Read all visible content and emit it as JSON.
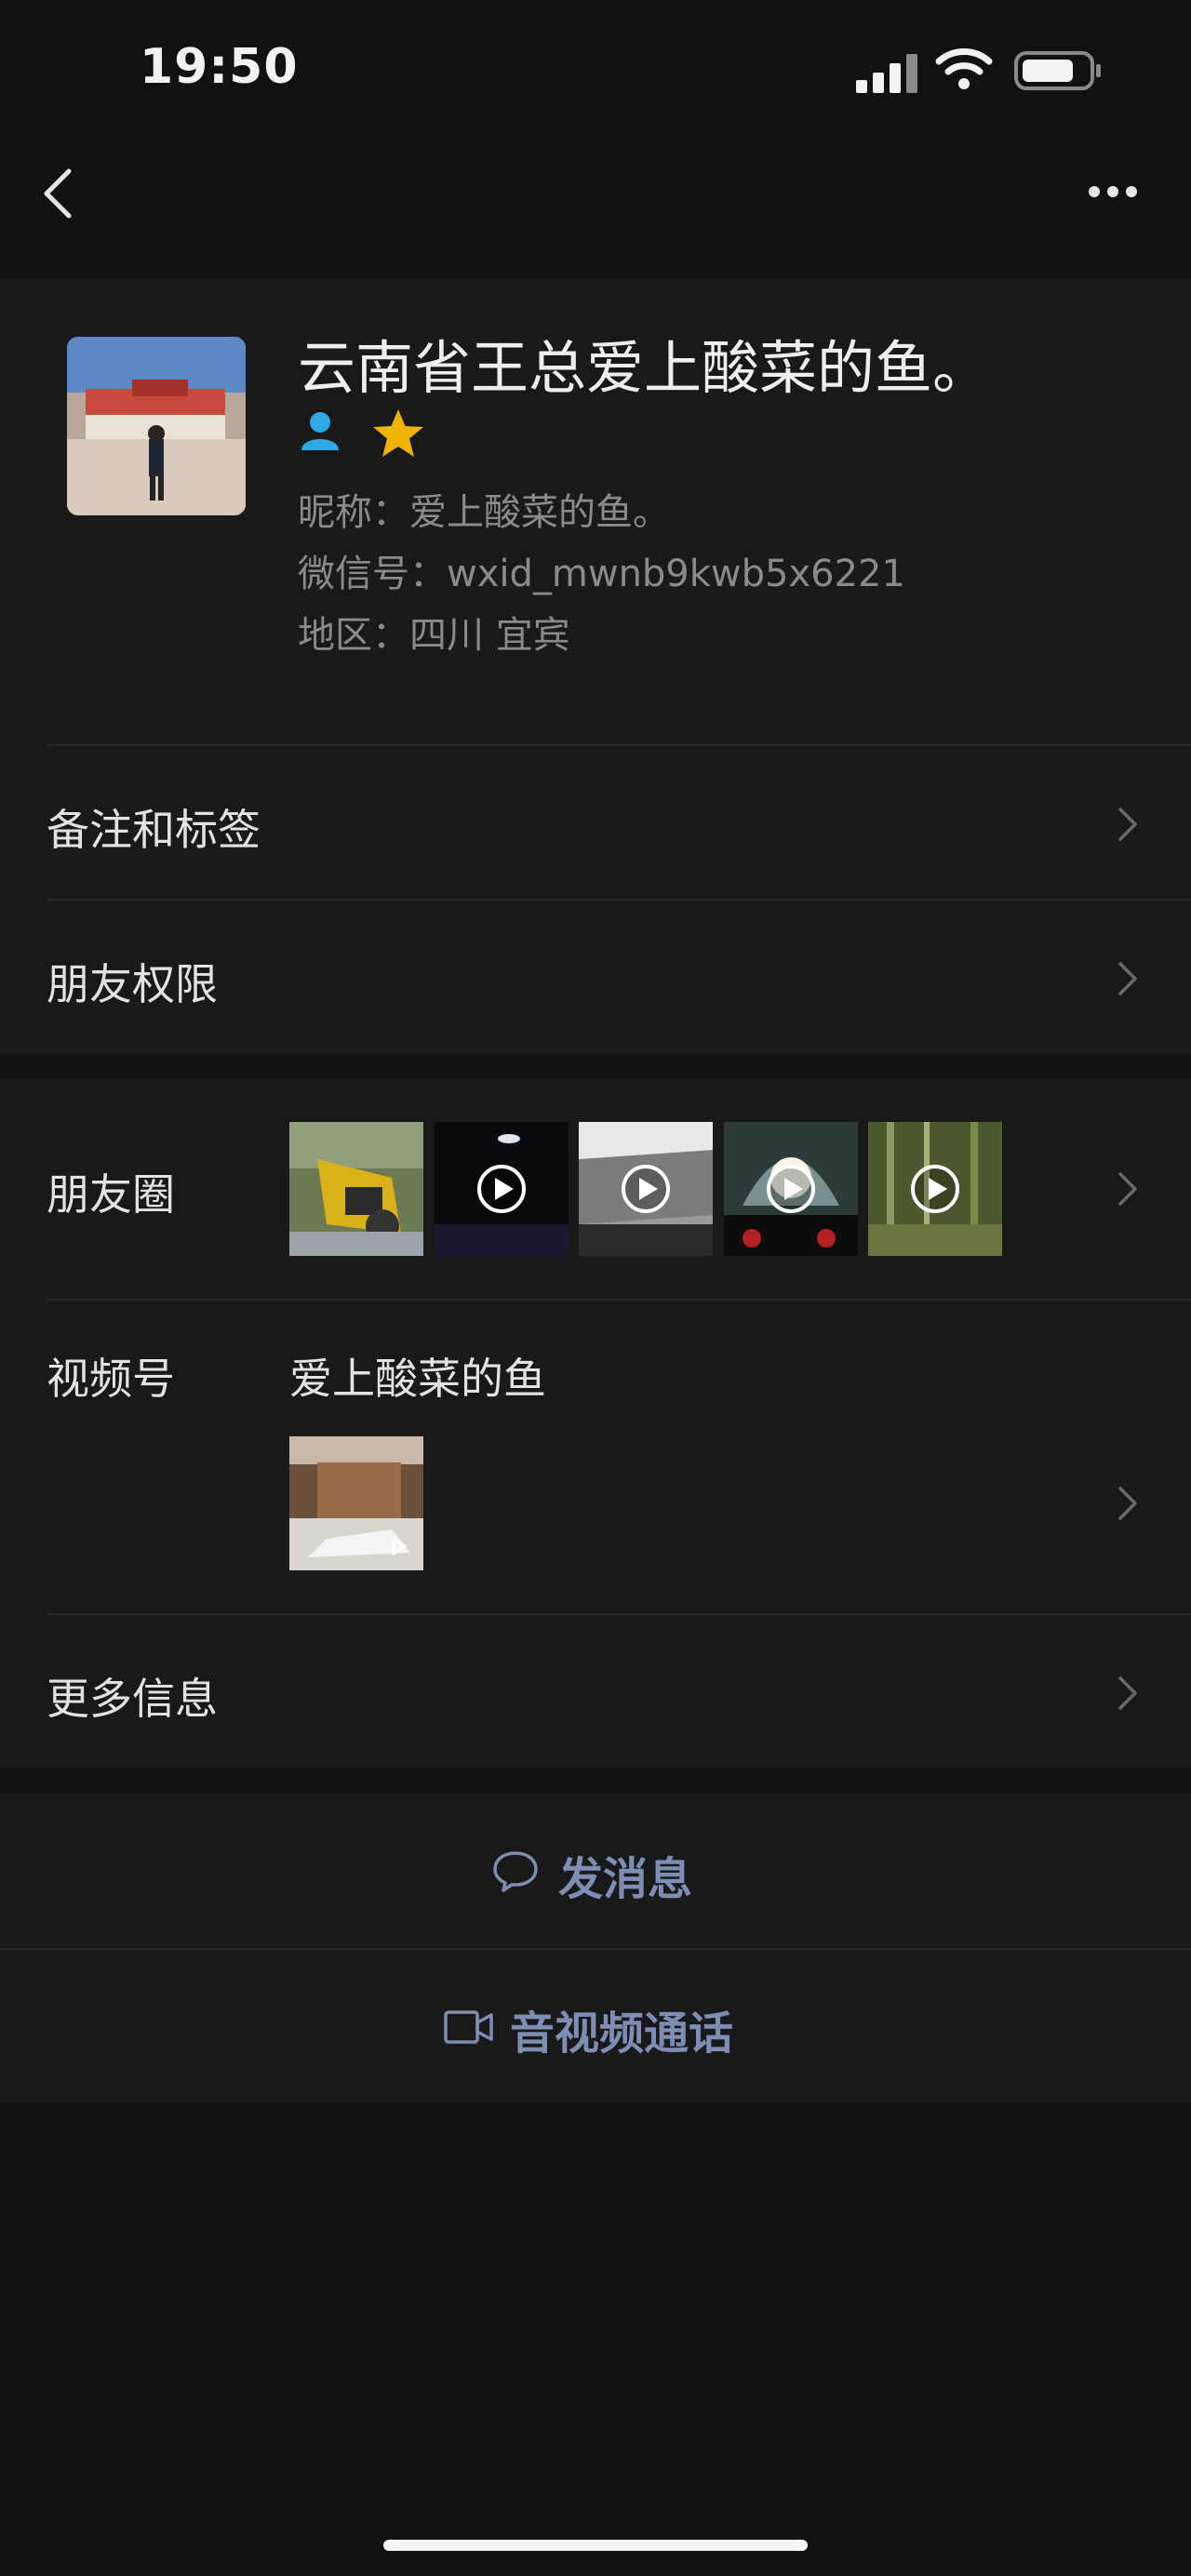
{
  "status_bar": {
    "time": "19:50"
  },
  "profile": {
    "display_name": "云南省王总爱上酸菜的鱼。",
    "nickname_label": "昵称",
    "nickname": "爱上酸菜的鱼。",
    "wechat_id_label": "微信号",
    "wechat_id": "wxid_mwnb9kwb5x6221",
    "region_label": "地区",
    "region": "四川 宜宾",
    "nickname_line": "昵称：爱上酸菜的鱼。",
    "wechat_id_line": "微信号：wxid_mwnb9kwb5x6221",
    "region_line": "地区：四川 宜宾"
  },
  "rows": {
    "remarks_tags": "备注和标签",
    "friend_permissions": "朋友权限",
    "moments": "朋友圈",
    "channels": "视频号",
    "channels_name": "爱上酸菜的鱼",
    "more_info": "更多信息"
  },
  "moments_thumbs": [
    {
      "kind": "photo",
      "icon": "photo-thumbnail"
    },
    {
      "kind": "video",
      "icon": "play-icon"
    },
    {
      "kind": "video",
      "icon": "play-icon"
    },
    {
      "kind": "video",
      "icon": "play-icon"
    },
    {
      "kind": "video",
      "icon": "play-icon"
    }
  ],
  "actions": {
    "send_message": "发消息",
    "video_call": "音视频通话"
  },
  "colors": {
    "background": "#111111",
    "card": "#191919",
    "accent_link": "#7d8db3",
    "contact_icon": "#2fa8e6",
    "star": "#f0b400"
  }
}
